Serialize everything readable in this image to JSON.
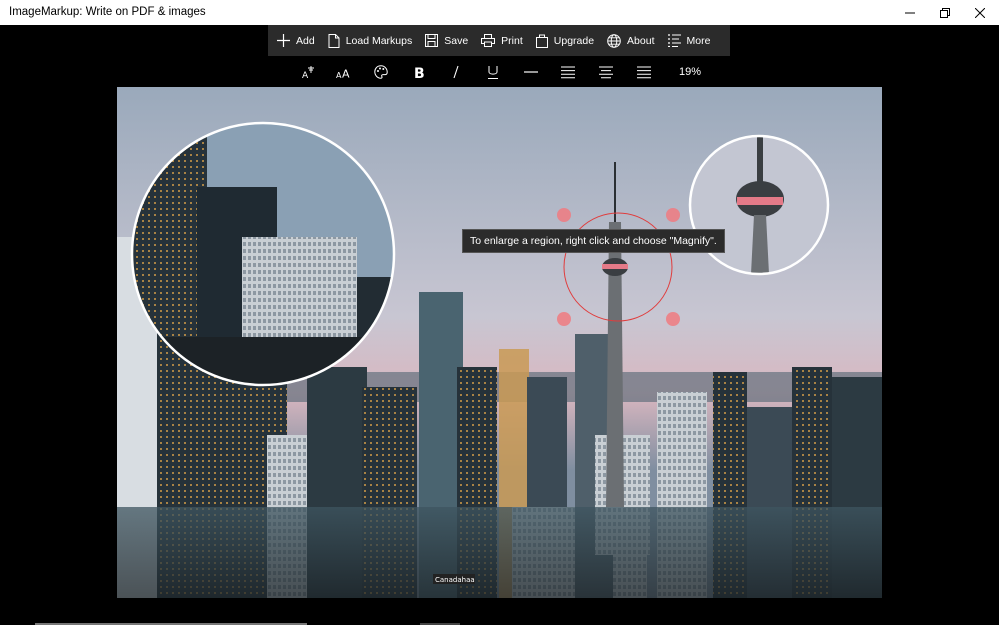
{
  "window": {
    "title": "ImageMarkup: Write on PDF & images",
    "controls": [
      "minimize-icon",
      "restore-icon",
      "close-icon"
    ]
  },
  "toolbar": {
    "items": [
      {
        "label": "Add",
        "icon": "plus-icon"
      },
      {
        "label": "Load Markups",
        "icon": "file-icon"
      },
      {
        "label": "Save",
        "icon": "save-icon"
      },
      {
        "label": "Print",
        "icon": "print-icon"
      },
      {
        "label": "Upgrade",
        "icon": "upgrade-icon"
      },
      {
        "label": "About",
        "icon": "globe-icon"
      },
      {
        "label": "More",
        "icon": "more-list-icon"
      }
    ]
  },
  "format_bar": {
    "items": [
      "text-style-icon",
      "font-size-icon",
      "color-palette-icon",
      "bold-icon",
      "italic-icon",
      "underline-icon",
      "line-icon",
      "align-left-icon",
      "align-center-icon",
      "align-right-icon"
    ],
    "zoom": "19%"
  },
  "canvas": {
    "tooltip": "To enlarge a region, right click and choose \"Magnify\".",
    "sign_text": "Canadahaa",
    "accent_color": "#e03c3c",
    "handle_color": "#f07a80"
  }
}
